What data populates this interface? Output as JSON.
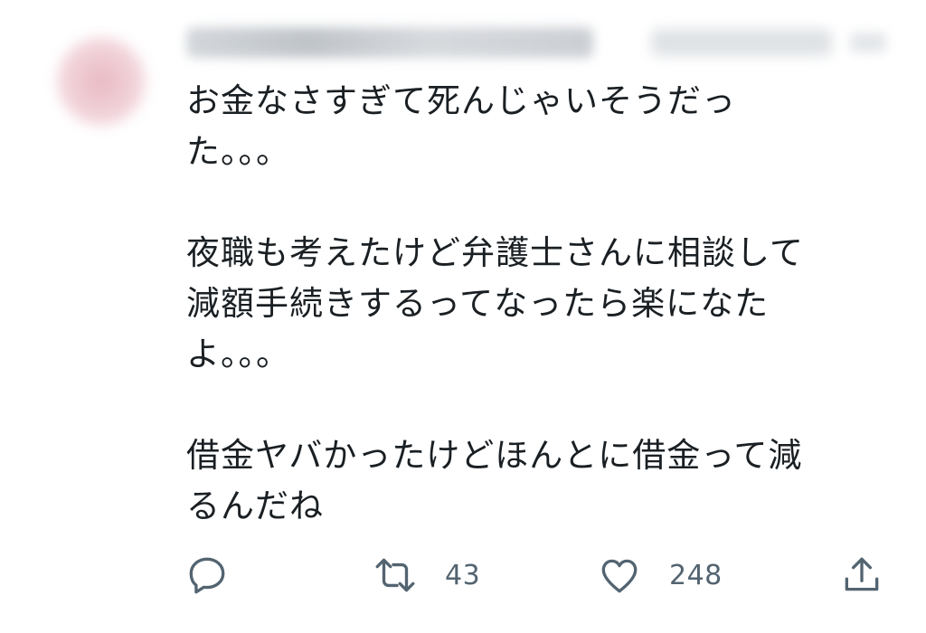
{
  "tweet": {
    "author_blurred": true,
    "body": {
      "paragraphs": [
        {
          "lines": [
            "お金なさすぎて死んじゃいそうだっ",
            "た。。。"
          ]
        },
        {
          "lines": [
            "夜職も考えたけど弁護士さんに相談して",
            "減額手続きするってなったら楽になた",
            "よ。。。"
          ]
        },
        {
          "lines": [
            "借金ヤバかったけどほんとに借金って減",
            "るんだね"
          ]
        }
      ]
    },
    "actions": {
      "reply": {
        "icon": "reply-icon",
        "count": ""
      },
      "retweet": {
        "icon": "retweet-icon",
        "count": "43"
      },
      "like": {
        "icon": "heart-icon",
        "count": "248"
      },
      "share": {
        "icon": "share-icon"
      }
    }
  },
  "colors": {
    "background": "#ffffff",
    "text": "#0f1419",
    "secondary": "#536471"
  }
}
